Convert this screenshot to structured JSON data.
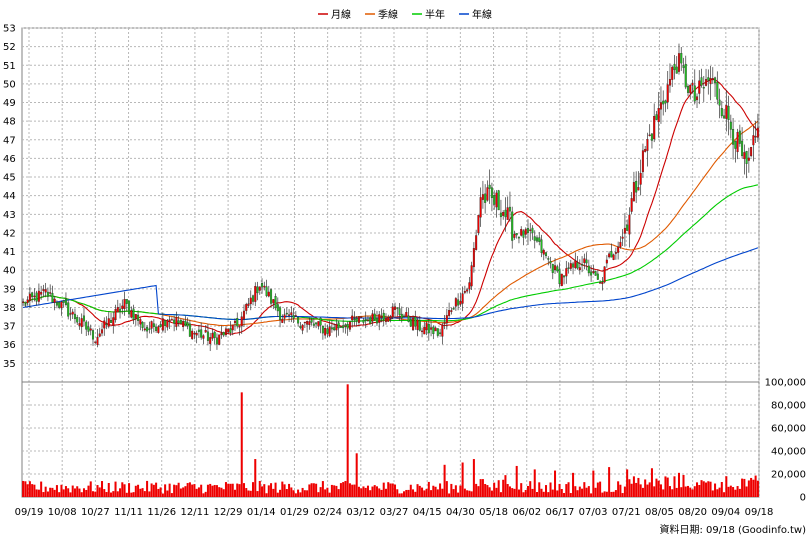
{
  "chart_data": {
    "type": "candlestick",
    "legend": {
      "placement": "top-center",
      "items": [
        {
          "name": "月線",
          "color": "#cc0000"
        },
        {
          "name": "季線",
          "color": "#e05a00"
        },
        {
          "name": "半年",
          "color": "#00cc00"
        },
        {
          "name": "年線",
          "color": "#0044cc"
        }
      ]
    },
    "price_axis": {
      "min": 34,
      "max": 53,
      "ticks": [
        35,
        36,
        37,
        38,
        39,
        40,
        41,
        42,
        43,
        44,
        45,
        46,
        47,
        48,
        49,
        50,
        51,
        52,
        53
      ],
      "position": "left"
    },
    "volume_axis": {
      "min": 0,
      "max": 100000,
      "ticks": [
        0,
        20000,
        40000,
        60000,
        80000,
        100000
      ],
      "tick_labels": [
        "0",
        "20,000",
        "40,000",
        "60,000",
        "80,000",
        "100,000"
      ],
      "position": "right"
    },
    "x_labels": [
      "09/19",
      "10/08",
      "10/27",
      "11/11",
      "11/26",
      "12/11",
      "12/29",
      "01/14",
      "01/29",
      "02/24",
      "03/12",
      "03/27",
      "04/15",
      "04/30",
      "05/18",
      "06/02",
      "06/17",
      "07/03",
      "07/21",
      "08/05",
      "08/20",
      "09/04",
      "09/18"
    ],
    "grid": true,
    "up_color": "#ee0000",
    "down_color": "#22bb22",
    "volume_color": "#ee0000",
    "close_keyframes": [
      [
        0,
        38.2
      ],
      [
        10,
        38.8
      ],
      [
        22,
        37.6
      ],
      [
        32,
        36.4
      ],
      [
        45,
        38.2
      ],
      [
        55,
        36.8
      ],
      [
        65,
        37.5
      ],
      [
        75,
        36.7
      ],
      [
        85,
        36.3
      ],
      [
        95,
        37.0
      ],
      [
        105,
        39.3
      ],
      [
        115,
        37.5
      ],
      [
        125,
        37.2
      ],
      [
        135,
        36.8
      ],
      [
        145,
        37.2
      ],
      [
        155,
        37.4
      ],
      [
        165,
        37.9
      ],
      [
        175,
        37.0
      ],
      [
        185,
        36.6
      ],
      [
        190,
        38.0
      ],
      [
        198,
        39.2
      ],
      [
        203,
        44.0
      ],
      [
        212,
        43.5
      ],
      [
        218,
        42.0
      ],
      [
        226,
        41.8
      ],
      [
        238,
        39.6
      ],
      [
        248,
        40.5
      ],
      [
        256,
        39.2
      ],
      [
        260,
        40.7
      ],
      [
        266,
        41.8
      ],
      [
        276,
        46.5
      ],
      [
        285,
        49.5
      ],
      [
        290,
        51.2
      ],
      [
        298,
        49.2
      ],
      [
        305,
        50.3
      ],
      [
        314,
        47.8
      ],
      [
        321,
        45.3
      ],
      [
        326,
        47.4
      ]
    ],
    "volume_spikes": [
      [
        97,
        91000
      ],
      [
        103,
        33000
      ],
      [
        144,
        98000
      ],
      [
        148,
        38000
      ],
      [
        187,
        28000
      ],
      [
        195,
        30000
      ],
      [
        200,
        33000
      ],
      [
        219,
        27000
      ],
      [
        227,
        24000
      ],
      [
        236,
        23000
      ],
      [
        244,
        21000
      ],
      [
        253,
        23000
      ],
      [
        260,
        26000
      ],
      [
        268,
        24000
      ],
      [
        279,
        25000
      ],
      [
        291,
        21000
      ]
    ],
    "footer": "資料日期: 09/18 (Goodinfo.tw)"
  }
}
